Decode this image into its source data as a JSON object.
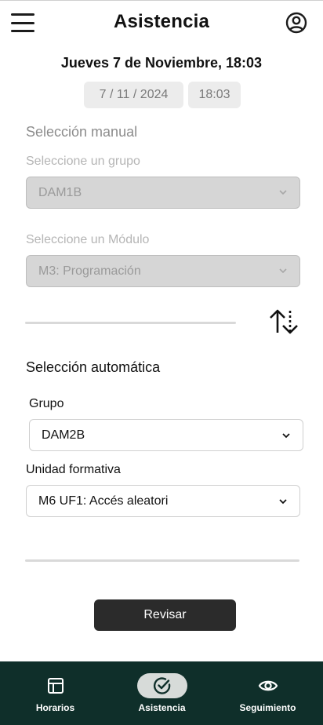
{
  "header": {
    "title": "Asistencia"
  },
  "datetime": {
    "heading": "Jueves 7 de Noviembre, 18:03",
    "date": "7 / 11 / 2024",
    "time": "18:03"
  },
  "manual": {
    "title": "Selección manual",
    "group_label": "Seleccione un grupo",
    "group_value": "DAM1B",
    "module_label": "Seleccione un Módulo",
    "module_value": "M3: Programación"
  },
  "automatic": {
    "title": "Selección automática",
    "group_label": "Grupo",
    "group_value": "DAM2B",
    "unit_label": "Unidad formativa",
    "unit_value": "M6 UF1: Accés aleatori"
  },
  "actions": {
    "review_label": "Revisar"
  },
  "nav": {
    "items": [
      {
        "label": "Horarios",
        "icon": "calendar-grid-icon"
      },
      {
        "label": "Asistencia",
        "icon": "check-circle-icon",
        "active": true
      },
      {
        "label": "Seguimiento",
        "icon": "eye-icon"
      }
    ]
  },
  "colors": {
    "nav_background": "#0f2f2a",
    "active_pill": "#d7dbd9",
    "review_button": "#2b2b2b"
  }
}
